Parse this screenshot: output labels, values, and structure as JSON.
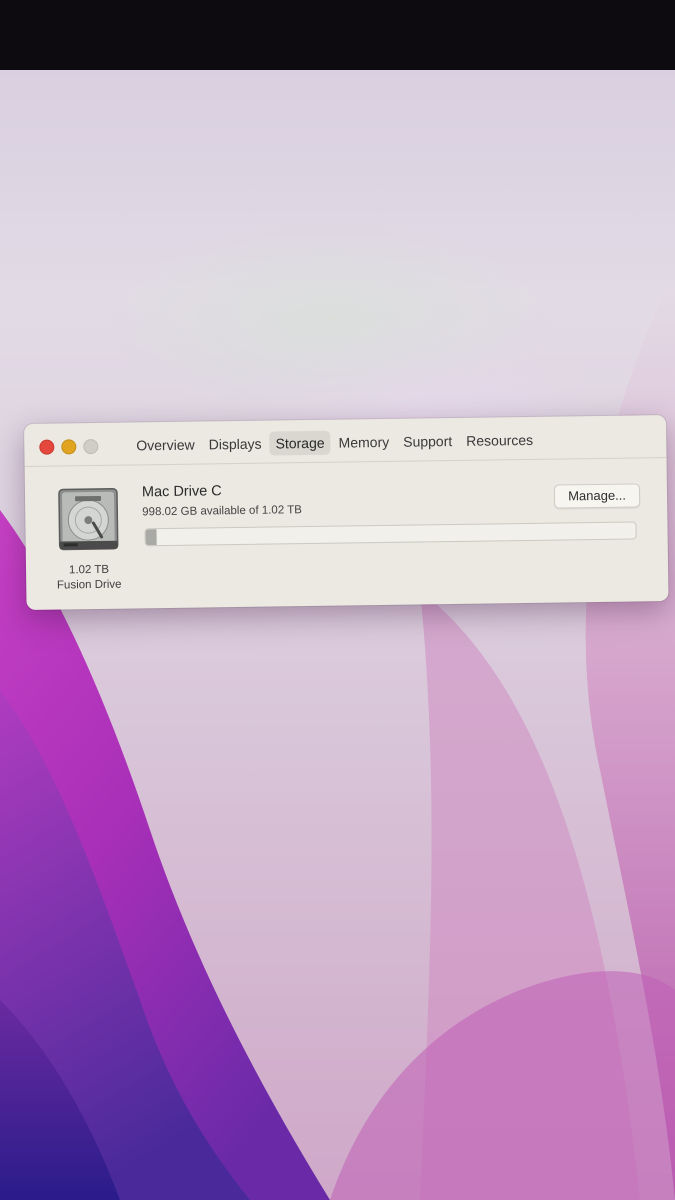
{
  "window": {
    "tabs": [
      {
        "label": "Overview"
      },
      {
        "label": "Displays"
      },
      {
        "label": "Storage"
      },
      {
        "label": "Memory"
      },
      {
        "label": "Support"
      },
      {
        "label": "Resources"
      }
    ],
    "selected_tab": "Storage"
  },
  "storage": {
    "drive_name": "Mac Drive C",
    "available_text": "998.02 GB available of 1.02 TB",
    "capacity_label": "1.02 TB",
    "drive_type": "Fusion Drive",
    "manage_label": "Manage...",
    "used_fraction": 0.022,
    "icon": "hard-drive-icon"
  },
  "colors": {
    "close": "#e4473c",
    "minimize": "#e0a420",
    "zoom_disabled": "#cfcdc6",
    "wallpaper_magenta": "#b03cc0",
    "wallpaper_violet": "#5a2a9e"
  }
}
